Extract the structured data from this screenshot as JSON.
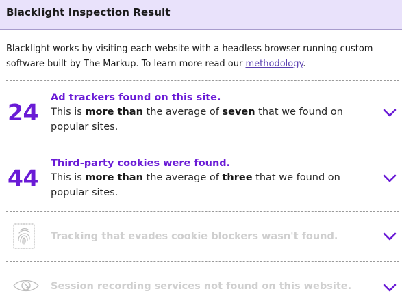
{
  "header": {
    "title": "Blacklight Inspection Result"
  },
  "intro": {
    "text": "Blacklight works by visiting each website with a headless browser running custom software built by The Markup. To learn more read our ",
    "link_label": "methodology",
    "end": "."
  },
  "results": [
    {
      "count": "24",
      "title": "Ad trackers found on this site.",
      "desc_pre": "This is ",
      "desc_comparator": "more than",
      "desc_mid": " the average of ",
      "desc_value": "seven",
      "desc_post": " that we found on popular sites."
    },
    {
      "count": "44",
      "title": "Third-party cookies were found.",
      "desc_pre": "This is ",
      "desc_comparator": "more than",
      "desc_mid": " the average of ",
      "desc_value": "three",
      "desc_post": " that we found on popular sites."
    },
    {
      "icon": "fingerprint-icon",
      "title": "Tracking that evades cookie blockers wasn't found."
    },
    {
      "icon": "eye-icon",
      "title": "Session recording services not found on this website."
    }
  ],
  "colors": {
    "accent": "#6a1bd6",
    "header_bg": "#e9e2fb",
    "muted_text": "#cfcfcf"
  }
}
